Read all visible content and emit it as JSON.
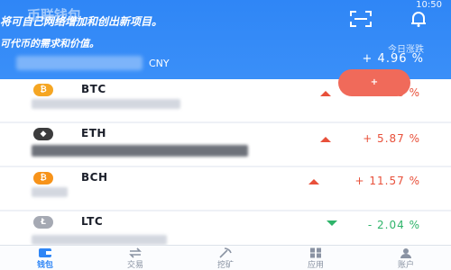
{
  "header": {
    "title": "币联钱包",
    "status_time": "10:50",
    "overlay_line1": "将可自己网络增加和创出新项目。",
    "overlay_line2": "可代币的需求和价值。",
    "asset_currency": "CNY",
    "change_label": "今日涨跌",
    "change_value": "+ 4.96 %",
    "accent_color": "#2f86f6"
  },
  "badge": {
    "label": "+"
  },
  "coins": [
    {
      "symbol": "BTC",
      "change": "+ 0.88 %",
      "direction": "up",
      "icon_color": "#f5a623",
      "icon": "btc-icon"
    },
    {
      "symbol": "ETH",
      "change": "+ 5.87 %",
      "direction": "up",
      "icon_color": "#3c3c3d",
      "icon": "eth-icon"
    },
    {
      "symbol": "BCH",
      "change": "+ 11.57 %",
      "direction": "up",
      "icon_color": "#f7931a",
      "icon": "bch-icon"
    },
    {
      "symbol": "LTC",
      "change": "- 2.04 %",
      "direction": "down",
      "icon_color": "#a5a9b3",
      "icon": "ltc-icon"
    }
  ],
  "tabs": [
    {
      "label": "钱包",
      "icon": "wallet-icon",
      "active": true
    },
    {
      "label": "交易",
      "icon": "exchange-icon",
      "active": false
    },
    {
      "label": "挖矿",
      "icon": "mining-icon",
      "active": false
    },
    {
      "label": "应用",
      "icon": "apps-icon",
      "active": false
    },
    {
      "label": "账户",
      "icon": "account-icon",
      "active": false
    }
  ]
}
